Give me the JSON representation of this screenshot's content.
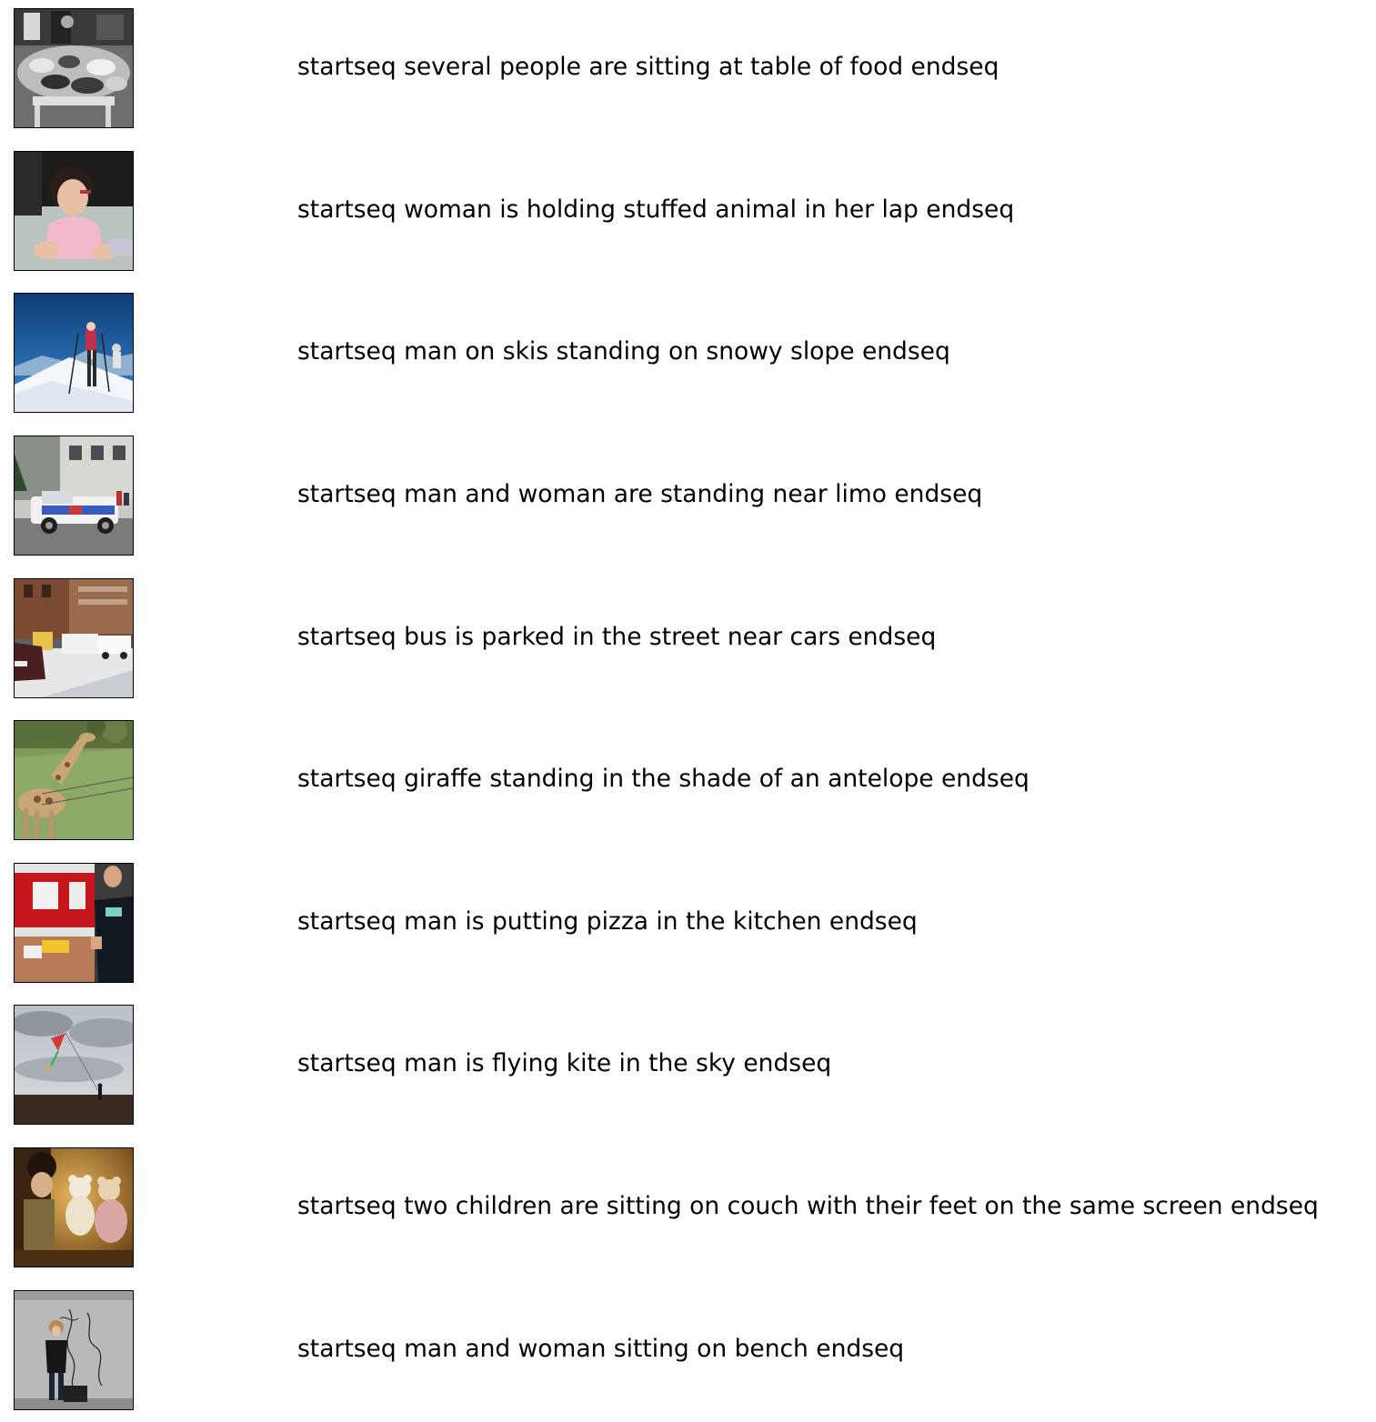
{
  "captions": [
    {
      "text": "startseq several people are sitting at table of food endseq"
    },
    {
      "text": "startseq woman is holding stuffed animal in her lap endseq"
    },
    {
      "text": "startseq man on skis standing on snowy slope endseq"
    },
    {
      "text": "startseq man and woman are standing near limo endseq"
    },
    {
      "text": "startseq bus is parked in the street near cars endseq"
    },
    {
      "text": "startseq giraffe standing in the shade of an antelope endseq"
    },
    {
      "text": "startseq man is putting pizza in the kitchen endseq"
    },
    {
      "text": "startseq man is flying kite in the sky endseq"
    },
    {
      "text": "startseq two children are sitting on couch with their feet on the same screen endseq"
    },
    {
      "text": "startseq man and woman sitting on bench endseq"
    }
  ]
}
